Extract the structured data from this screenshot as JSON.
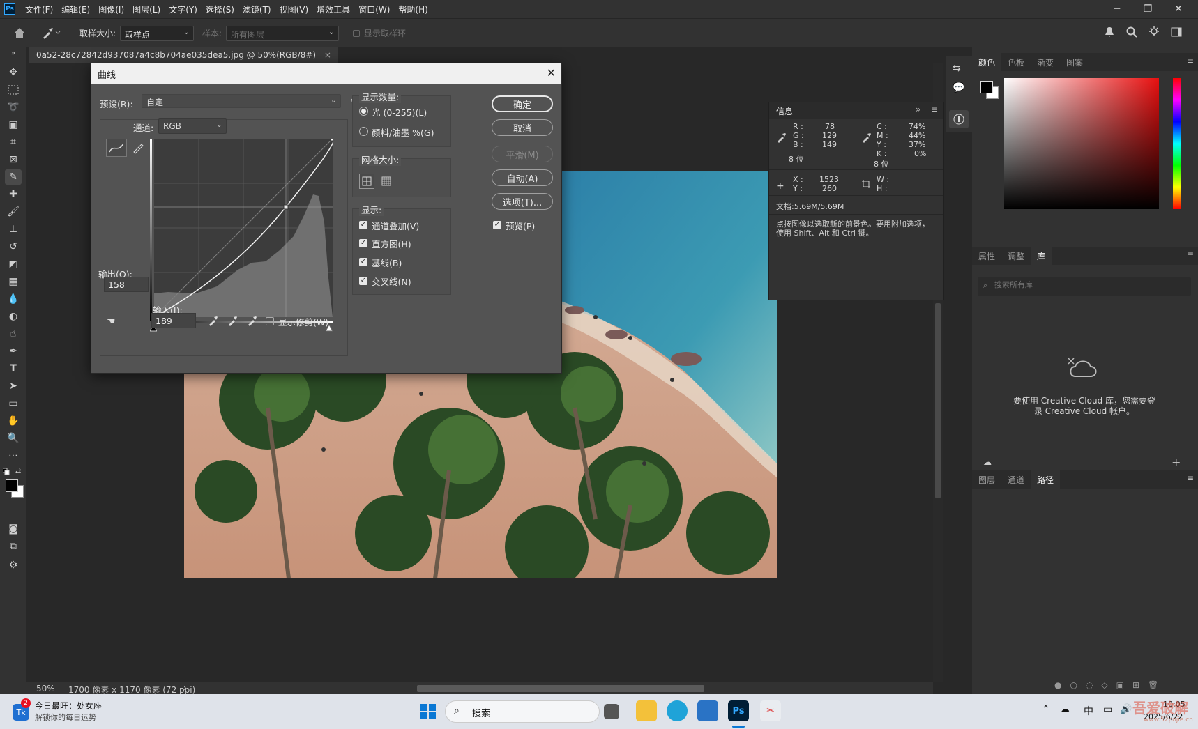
{
  "app": {
    "logo": "Ps"
  },
  "menu": [
    "文件(F)",
    "编辑(E)",
    "图像(I)",
    "图层(L)",
    "文字(Y)",
    "选择(S)",
    "滤镜(T)",
    "视图(V)",
    "增效工具",
    "窗口(W)",
    "帮助(H)"
  ],
  "window_controls": {
    "minimize": "─",
    "restore": "❐",
    "close": "✕"
  },
  "options_bar": {
    "sample_size_label": "取样大小:",
    "sample_size_value": "取样点",
    "sample_label": "样本:",
    "sample_value": "所有图层",
    "show_ring_label": "显示取样环"
  },
  "document": {
    "tab_title": "0a52-28c72842d937087a4c8b704ae035dea5.jpg @ 50%(RGB/8#)",
    "tab_close": "×",
    "zoom": "50%",
    "doc_info": "1700 像素 x 1170 像素 (72 ppi)",
    "status_arrow": "›"
  },
  "curves_dialog": {
    "title": "曲线",
    "preset_label": "预设(R):",
    "preset_value": "自定",
    "channel_label": "通道:",
    "channel_value": "RGB",
    "output_label": "输出(O):",
    "output_value": "158",
    "input_label": "输入(I):",
    "input_value": "189",
    "show_clipping_label": "显示修剪(W)",
    "display_amount_title": "显示数量:",
    "light_label": "光 (0-255)(L)",
    "pigment_label": "颜料/油墨 %(G)",
    "grid_size_title": "网格大小:",
    "show_title": "显示:",
    "channel_overlay_label": "通道叠加(V)",
    "histogram_label": "直方图(H)",
    "baseline_label": "基线(B)",
    "intersection_label": "交叉线(N)",
    "ok_label": "确定",
    "cancel_label": "取消",
    "smooth_label": "平滑(M)",
    "auto_label": "自动(A)",
    "options_label": "选项(T)...",
    "preview_label": "预览(P)",
    "curve_point": {
      "input": 189,
      "output": 158
    }
  },
  "info_panel": {
    "title": "信息",
    "r_label": "R :",
    "r": "78",
    "g_label": "G :",
    "g": "129",
    "b_label": "B :",
    "b": "149",
    "bits_left": "8 位",
    "c_label": "C :",
    "c": "74%",
    "m_label": "M :",
    "m": "44%",
    "y_label": "Y :",
    "y": "37%",
    "k_label": "K :",
    "k": "0%",
    "bits_right": "8 位",
    "x_label": "X :",
    "x": "1523",
    "yc_label": "Y :",
    "yc": "260",
    "w_label": "W :",
    "h_label": "H :",
    "doc_size": "文档:5.69M/5.69M",
    "hint": "点按图像以选取新的前景色。要用附加选项，使用 Shift、Alt 和 Ctrl 键。"
  },
  "right_panels": {
    "color_tabs": [
      "颜色",
      "色板",
      "渐变",
      "图案"
    ],
    "props_tabs": [
      "属性",
      "调整",
      "库"
    ],
    "library_search_placeholder": "搜索所有库",
    "library_message": "要使用 Creative Cloud 库，您需要登录 Creative Cloud 帐户。",
    "layers_tabs": [
      "图层",
      "通道",
      "路径"
    ]
  },
  "taskbar": {
    "news_badge": "2",
    "news_title": "今日最旺：处女座",
    "news_subtitle": "解锁你的每日运势",
    "search_label": "搜索",
    "ime": "中",
    "time": "10:05",
    "date": "2025/6/22",
    "watermark": "吾爱破解",
    "watermark_url": "www.52pojie.cn"
  },
  "colors": {
    "accent": "#31a8ff",
    "panel": "#323232",
    "dialog": "#535353"
  }
}
